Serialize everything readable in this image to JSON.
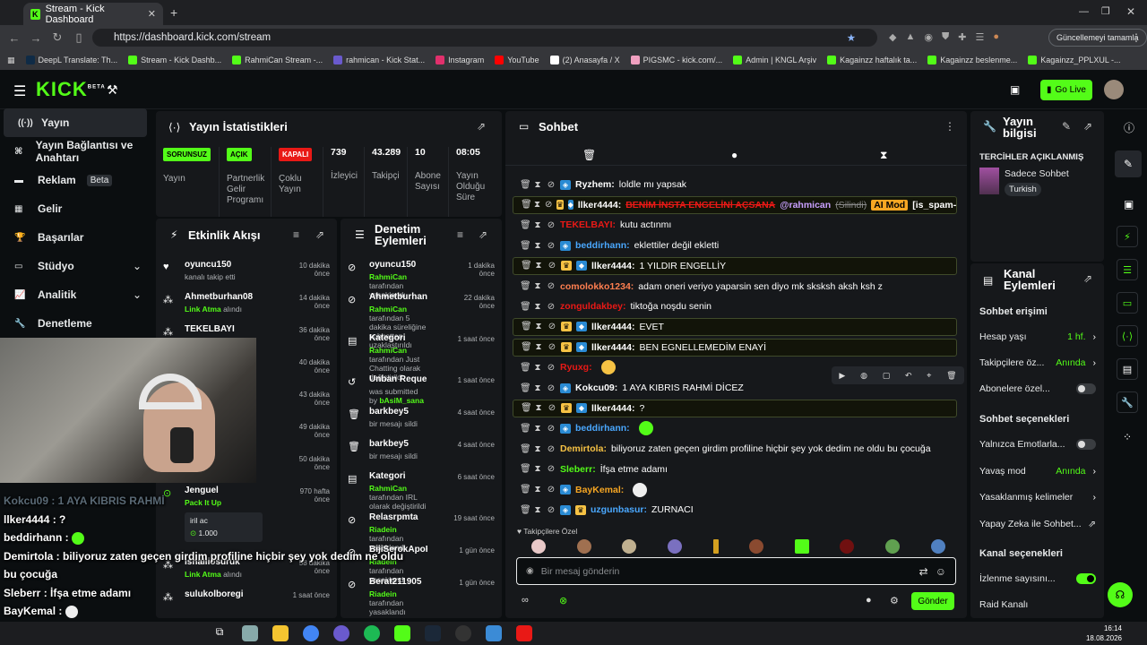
{
  "browser": {
    "tab_title": "Stream - Kick Dashboard",
    "url": "https://dashboard.kick.com/stream",
    "update_button": "Güncellemeyi tamamla",
    "bookmarks": [
      {
        "label": "DeepL Translate: Th...",
        "color": "#0f2b46"
      },
      {
        "label": "Stream - Kick Dashb...",
        "color": "#53fc18"
      },
      {
        "label": "RahmiCan Stream -...",
        "color": "#53fc18"
      },
      {
        "label": "rahmican - Kick Stat...",
        "color": "#6a5acd"
      },
      {
        "label": "Instagram",
        "color": "#e1306c"
      },
      {
        "label": "YouTube",
        "color": "#ff0000"
      },
      {
        "label": "(2) Anasayfa / X",
        "color": "#ffffff"
      },
      {
        "label": "PIGSMC - kick.com/...",
        "color": "#f0a0c0"
      },
      {
        "label": "Admin | KNGL Arşiv",
        "color": "#53fc18"
      },
      {
        "label": "Kagainzz haftalık ta...",
        "color": "#53fc18"
      },
      {
        "label": "Kagainzz beslenme...",
        "color": "#53fc18"
      },
      {
        "label": "Kagainzz_PPLXUL -...",
        "color": "#53fc18"
      }
    ]
  },
  "header": {
    "logo": "KICK",
    "logo_beta": "BETA",
    "go_live": "Go Live"
  },
  "sidebar": {
    "items": [
      {
        "label": "Yayın",
        "icon": "live-icon"
      },
      {
        "label": "Yayın Bağlantısı ve Anahtarı",
        "icon": "link-icon"
      },
      {
        "label": "Reklam",
        "icon": "ad-icon",
        "badge": "Beta"
      },
      {
        "label": "Gelir",
        "icon": "money-icon"
      },
      {
        "label": "Başarılar",
        "icon": "trophy-icon"
      },
      {
        "label": "Stüdyo",
        "icon": "studio-icon"
      },
      {
        "label": "Analitik",
        "icon": "chart-icon"
      },
      {
        "label": "Denetleme",
        "icon": "wrench-icon"
      }
    ]
  },
  "stats": {
    "title": "Yayın İstatistikleri",
    "items": [
      {
        "badge": "SORUNSUZ",
        "badge_color": "#53fc18",
        "label": "Yayın"
      },
      {
        "badge": "AÇIK",
        "badge_color": "#53fc18",
        "label": "Partnerlik Gelir Programı"
      },
      {
        "badge": "KAPALI",
        "badge_color": "#e91916",
        "label": "Çoklu Yayın"
      },
      {
        "value": "739",
        "label": "İzleyici"
      },
      {
        "value": "43.289",
        "label": "Takipçi"
      },
      {
        "value": "10",
        "label": "Abone Sayısı"
      },
      {
        "value": "08:05",
        "label": "Yayın Olduğu Süre"
      }
    ]
  },
  "activity": {
    "title": "Etkinlik Akışı",
    "items": [
      {
        "name": "oyuncu150",
        "sub": "kanalı takip etti",
        "time": "10 dakika önce",
        "icon": "heart-icon"
      },
      {
        "name": "Ahmetburhan08",
        "sub_green": "Link Atma",
        "sub": " alındı",
        "time": "14 dakika önce",
        "icon": "item-icon"
      },
      {
        "name": "TEKELBAYI",
        "sub": "",
        "time": "36 dakika önce",
        "icon": "item-icon"
      },
      {
        "name": "",
        "sub": "",
        "time": "40 dakika önce",
        "icon": ""
      },
      {
        "name": "...ri",
        "sub": "",
        "time": "43 dakika önce",
        "icon": ""
      },
      {
        "name": "",
        "sub": "",
        "time": "49 dakika önce",
        "icon": ""
      },
      {
        "name": "...razy31",
        "sub": "",
        "time": "50 dakika önce",
        "icon": ""
      },
      {
        "name": "Jenguel",
        "sub_green": "Pack It Up",
        "sub": "",
        "time": "970 hafta önce",
        "icon": "coin-icon",
        "extra": "iril ac",
        "extra_value": "1.000"
      },
      {
        "name": "ishalliosuruk",
        "sub_green": "Link Atma",
        "sub": " alındı",
        "time": "58 dakika önce",
        "icon": "item-icon"
      },
      {
        "name": "sulukolboregi",
        "sub": "",
        "time": "1 saat önce",
        "icon": "item-icon"
      }
    ]
  },
  "moderation": {
    "title": "Denetim Eylemleri",
    "items": [
      {
        "name": "oyuncu150",
        "sub_green": "RahmiCan",
        "sub": " tarafından yasaklandı",
        "time": "1 dakika önce",
        "icon": "ban-icon"
      },
      {
        "name": "Ahmetburhan08",
        "sub_green": "RahmiCan",
        "sub": " tarafından 5 dakika süreliğine sohbetten uzaklaştırıldı",
        "time": "22 dakika önce",
        "icon": "timeout-icon"
      },
      {
        "name": "Kategori",
        "sub_green": "RahmiCan",
        "sub": " tarafından Just Chatting olarak değiştirildi",
        "time": "1 saat önce",
        "icon": "category-icon"
      },
      {
        "name": "Unban Request",
        "sub": "was submitted by ",
        "sub_green2": "bAsiM_sana",
        "time": "1 saat önce",
        "icon": "unban-icon"
      },
      {
        "name": "barkbey5",
        "sub": "bir mesajı sildi",
        "time": "4 saat önce",
        "icon": "trash-icon"
      },
      {
        "name": "barkbey5",
        "sub": "bir mesajı sildi",
        "time": "4 saat önce",
        "icon": "trash-icon"
      },
      {
        "name": "Kategori",
        "sub_green": "RahmiCan",
        "sub": " tarafından IRL olarak değiştirildi",
        "time": "6 saat önce",
        "icon": "category-icon"
      },
      {
        "name": "Relasrpmta",
        "sub_green": "Riadein",
        "sub": " tarafından yasaklandı",
        "time": "19 saat önce",
        "icon": "ban-icon"
      },
      {
        "name": "BijiSerokApoKurdestan21",
        "sub_green": "Riadein",
        "sub": " tarafından yasaklandı",
        "time": "1 gün önce",
        "icon": "ban-icon"
      },
      {
        "name": "Berat211905",
        "sub_green": "Riadein",
        "sub": " tarafından yasaklandı",
        "time": "1 gün önce",
        "icon": "ban-icon"
      }
    ]
  },
  "chat": {
    "title": "Sohbet",
    "messages": [
      {
        "user": "Ryzhem",
        "color": "#ffffff",
        "text": "loldle mı yapsak",
        "badges": [
          "mod"
        ],
        "hl": false
      },
      {
        "user": "llker4444",
        "color": "#ffffff",
        "text": "BENİM İNSTA ENGELİNİ AÇSANA",
        "mention": "@rahmican",
        "deleted": "(Silindi)",
        "tag": "AI Mod",
        "tag2": "[is_spam-true]",
        "badges": [
          "vip",
          "sub"
        ],
        "hl": true
      },
      {
        "user": "TEKELBAYI",
        "color": "#e91916",
        "text": "kutu actınmı",
        "badges": [],
        "hl": false
      },
      {
        "user": "beddirhann",
        "color": "#4aa8ff",
        "text": "eklettiler değil ekletti",
        "badges": [
          "mod"
        ],
        "hl": false
      },
      {
        "user": "llker4444",
        "color": "#ffffff",
        "text": "1 YILDIR ENGELLİY",
        "badges": [
          "vip",
          "sub"
        ],
        "hl": true
      },
      {
        "user": "comolokko1234",
        "color": "#ff7f50",
        "text": "adam oneri veriyo yaparsin sen diyo mk sksksh aksh ksh z",
        "badges": [],
        "hl": false
      },
      {
        "user": "zonguldakbey",
        "color": "#e91916",
        "text": "tiktoğa noşdu senin",
        "badges": [],
        "hl": false
      },
      {
        "user": "llker4444",
        "color": "#ffffff",
        "text": "EVET",
        "badges": [
          "vip",
          "sub"
        ],
        "hl": true
      },
      {
        "user": "llker4444",
        "color": "#ffffff",
        "text": "BEN EGNELLEMEDİM ENAYİ",
        "badges": [
          "vip",
          "sub"
        ],
        "hl": true
      },
      {
        "user": "Ryuxg",
        "color": "#e91916",
        "text": "",
        "emote": "#f6c244",
        "badges": [],
        "hl": false
      },
      {
        "user": "Kokcu09",
        "color": "#ffffff",
        "text": "1 AYA KIBRIS RAHMİ DİCEZ",
        "badges": [
          "mod"
        ],
        "hl": false
      },
      {
        "user": "llker4444",
        "color": "#ffffff",
        "text": "?",
        "badges": [
          "vip",
          "sub"
        ],
        "hl": true
      },
      {
        "user": "beddirhann",
        "color": "#4aa8ff",
        "text": "",
        "emote": "#53fc18",
        "badges": [
          "mod"
        ],
        "hl": false
      },
      {
        "user": "Demirtola",
        "color": "#f6c244",
        "text": "biliyoruz zaten geçen girdim profiline hiçbir şey yok dedim ne oldu bu çocuğa",
        "badges": [],
        "hl": false
      },
      {
        "user": "Sleberr",
        "color": "#53fc18",
        "text": "İfşa etme adamı",
        "badges": [],
        "hl": false
      },
      {
        "user": "BayKemal",
        "color": "#f6a623",
        "text": "",
        "emote": "#eeeeee",
        "badges": [
          "mod"
        ],
        "hl": false
      },
      {
        "user": "uzgunbasur",
        "color": "#4aa8ff",
        "text": "ZURNACI",
        "badges": [
          "mod",
          "vip"
        ],
        "hl": false
      }
    ],
    "emote_label": "Takipçilere Özel",
    "input_placeholder": "Bir mesaj gönderin",
    "send": "Gönder"
  },
  "stream_info": {
    "title": "Yayın bilgisi",
    "label": "TERCİHLER AÇIKLANMIŞ",
    "category": "Sadece Sohbet",
    "language": "Turkish"
  },
  "channel_actions": {
    "title": "Kanal Eylemleri",
    "access_title": "Sohbet erişimi",
    "rows1": [
      {
        "label": "Hesap yaşı",
        "value": "1 hf.",
        "type": "link"
      },
      {
        "label": "Takipçilere öz...",
        "value": "Anında",
        "type": "link"
      },
      {
        "label": "Abonelere özel...",
        "value": "",
        "type": "toggle",
        "on": false
      }
    ],
    "chat_opts_title": "Sohbet seçenekleri",
    "rows2": [
      {
        "label": "Yalnızca Emotlarla...",
        "value": "",
        "type": "toggle",
        "on": false
      },
      {
        "label": "Yavaş mod",
        "value": "Anında",
        "type": "link"
      },
      {
        "label": "Yasaklanmış kelimeler",
        "value": "",
        "type": "link"
      },
      {
        "label": "Yapay Zeka ile Sohbet...",
        "value": "",
        "type": "ext"
      }
    ],
    "channel_opts_title": "Kanal seçenekleri",
    "rows3": [
      {
        "label": "İzlenme sayısını...",
        "value": "",
        "type": "toggle",
        "on": true
      },
      {
        "label": "Raid Kanalı",
        "value": "",
        "type": "none"
      }
    ]
  },
  "overlay": {
    "lines": [
      {
        "text": "Kokcu09 : 1 AYA KIBRIS RAHMİ",
        "color": "#5a6a76"
      },
      {
        "text": "llker4444 : ?",
        "user_color": "#ffffff"
      },
      {
        "text": "beddirhann : ",
        "user_color": "#4aa8ff"
      },
      {
        "text": "Demirtola : biliyoruz zaten geçen girdim profiline hiçbir şey yok dedim ne oldu",
        "user_color": "#f6c244"
      },
      {
        "text": "bu çocuğa"
      },
      {
        "text": "Sleberr : İfşa etme adamı",
        "user_color": "#53fc18"
      },
      {
        "text": "BayKemal : ",
        "user_color": "#f6a623"
      },
      {
        "text": "uzgunbasur : ZURNACI"
      }
    ]
  },
  "taskbar": {
    "time": "16:14",
    "date": "18.08.2026"
  }
}
